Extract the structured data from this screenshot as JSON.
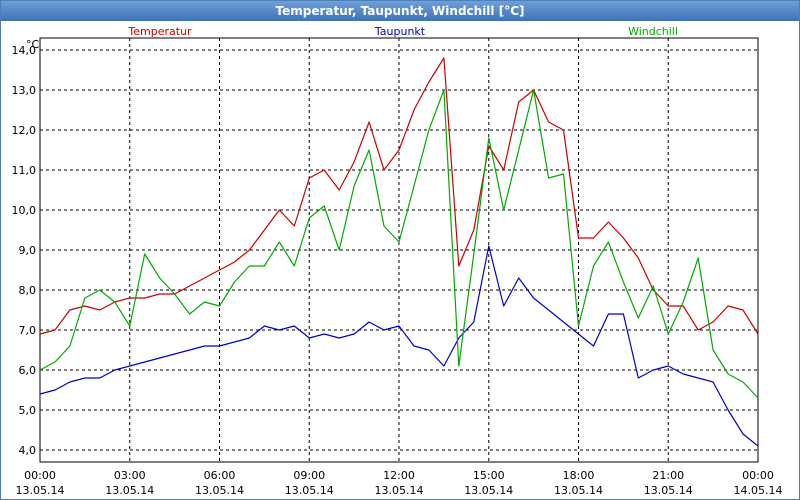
{
  "window": {
    "title": "Temperatur, Taupunkt, Windchill [°C]"
  },
  "chart_data": {
    "type": "line",
    "title": "Temperatur, Taupunkt, Windchill [°C]",
    "ylabel": "°C",
    "xlabel": "",
    "ylim": [
      3.7,
      14.3
    ],
    "xlim": [
      0,
      24
    ],
    "grid": true,
    "legend_position": "top",
    "y_ticks": [
      "4,0",
      "5,0",
      "6,0",
      "7,0",
      "8,0",
      "9,0",
      "10,0",
      "11,0",
      "12,0",
      "13,0",
      "14,0"
    ],
    "x_ticks": [
      {
        "time": "00:00",
        "date": "13.05.14"
      },
      {
        "time": "03:00",
        "date": "13.05.14"
      },
      {
        "time": "06:00",
        "date": "13.05.14"
      },
      {
        "time": "09:00",
        "date": "13.05.14"
      },
      {
        "time": "12:00",
        "date": "13.05.14"
      },
      {
        "time": "15:00",
        "date": "13.05.14"
      },
      {
        "time": "18:00",
        "date": "13.05.14"
      },
      {
        "time": "21:00",
        "date": "13.05.14"
      },
      {
        "time": "00:00",
        "date": "14.05.14"
      }
    ],
    "series": [
      {
        "name": "Temperatur",
        "color": "#cc0000",
        "x": [
          0,
          0.5,
          1,
          1.5,
          2,
          2.5,
          3,
          3.5,
          4,
          4.5,
          5,
          5.5,
          6,
          6.5,
          7,
          7.5,
          8,
          8.5,
          9,
          9.5,
          10,
          10.5,
          11,
          11.5,
          12,
          12.5,
          13,
          13.5,
          14,
          14.5,
          15,
          15.5,
          16,
          16.5,
          17,
          17.5,
          18,
          18.5,
          19,
          19.5,
          20,
          20.5,
          21,
          21.5,
          22,
          22.5,
          23,
          23.5,
          24
        ],
        "values": [
          6.9,
          7.0,
          7.5,
          7.6,
          7.5,
          7.7,
          7.8,
          7.8,
          7.9,
          7.9,
          8.1,
          8.3,
          8.5,
          8.7,
          9.0,
          9.5,
          10.0,
          9.6,
          10.8,
          11.0,
          10.5,
          11.2,
          12.2,
          11.0,
          11.5,
          12.5,
          13.2,
          13.8,
          8.6,
          9.5,
          11.6,
          11.0,
          12.7,
          13.0,
          12.2,
          12.0,
          9.3,
          9.3,
          9.7,
          9.3,
          8.8,
          8.0,
          7.6,
          7.6,
          7.0,
          7.2,
          7.6,
          7.5,
          6.9
        ]
      },
      {
        "name": "Taupunkt",
        "color": "#0000cc",
        "x": [
          0,
          0.5,
          1,
          1.5,
          2,
          2.5,
          3,
          3.5,
          4,
          4.5,
          5,
          5.5,
          6,
          6.5,
          7,
          7.5,
          8,
          8.5,
          9,
          9.5,
          10,
          10.5,
          11,
          11.5,
          12,
          12.5,
          13,
          13.5,
          14,
          14.5,
          15,
          15.5,
          16,
          16.5,
          17,
          17.5,
          18,
          18.5,
          19,
          19.5,
          20,
          20.5,
          21,
          21.5,
          22,
          22.5,
          23,
          23.5,
          24
        ],
        "values": [
          5.4,
          5.5,
          5.7,
          5.8,
          5.8,
          6.0,
          6.1,
          6.2,
          6.3,
          6.4,
          6.5,
          6.6,
          6.6,
          6.7,
          6.8,
          7.1,
          7.0,
          7.1,
          6.8,
          6.9,
          6.8,
          6.9,
          7.2,
          7.0,
          7.1,
          6.6,
          6.5,
          6.1,
          6.8,
          7.2,
          9.1,
          7.6,
          8.3,
          7.8,
          7.5,
          7.2,
          6.9,
          6.6,
          7.4,
          7.4,
          5.8,
          6.0,
          6.1,
          5.9,
          5.8,
          5.7,
          5.0,
          4.4,
          4.1
        ]
      },
      {
        "name": "Windchill",
        "color": "#00aa00",
        "x": [
          0,
          0.5,
          1,
          1.5,
          2,
          2.5,
          3,
          3.5,
          4,
          4.5,
          5,
          5.5,
          6,
          6.5,
          7,
          7.5,
          8,
          8.5,
          9,
          9.5,
          10,
          10.5,
          11,
          11.5,
          12,
          12.5,
          13,
          13.5,
          14,
          14.5,
          15,
          15.5,
          16,
          16.5,
          17,
          17.5,
          18,
          18.5,
          19,
          19.5,
          20,
          20.5,
          21,
          21.5,
          22,
          22.5,
          23,
          23.5,
          24
        ],
        "values": [
          6.0,
          6.2,
          6.6,
          7.8,
          8.0,
          7.7,
          7.1,
          8.9,
          8.3,
          7.9,
          7.4,
          7.7,
          7.6,
          8.2,
          8.6,
          8.6,
          9.2,
          8.6,
          9.8,
          10.1,
          9.0,
          10.6,
          11.5,
          9.6,
          9.2,
          10.6,
          12.0,
          13.0,
          6.1,
          8.9,
          11.8,
          10.0,
          11.5,
          13.0,
          10.8,
          10.9,
          7.1,
          8.6,
          9.2,
          8.2,
          7.3,
          8.1,
          6.9,
          7.7,
          8.8,
          6.5,
          5.9,
          5.7,
          5.3
        ]
      }
    ]
  }
}
